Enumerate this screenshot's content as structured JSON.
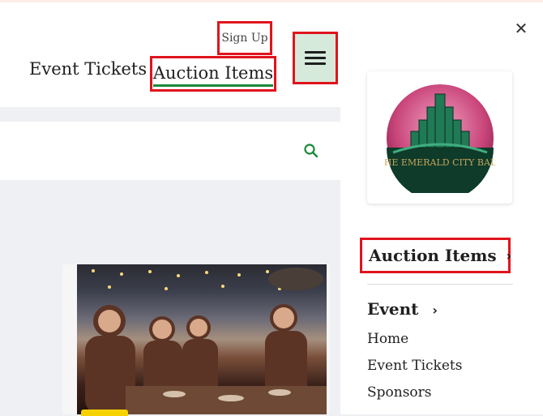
{
  "header": {
    "sign_up": "Sign Up",
    "nav": [
      {
        "label": "Event Tickets"
      },
      {
        "label": "Auction Items"
      }
    ]
  },
  "drawer": {
    "logo_text": "THE EMERALD CITY BALL",
    "primary": {
      "label": "Auction Items"
    },
    "event_section": {
      "label": "Event",
      "items": [
        "Home",
        "Event Tickets",
        "Sponsors"
      ]
    }
  },
  "icons": {
    "close": "close-icon",
    "menu": "hamburger-icon",
    "search": "search-icon",
    "chevron": "chevron-right-icon"
  },
  "colors": {
    "accent_green": "#1a8a3a",
    "highlight_red": "#e0141d",
    "menu_bg": "#d6eadc"
  }
}
